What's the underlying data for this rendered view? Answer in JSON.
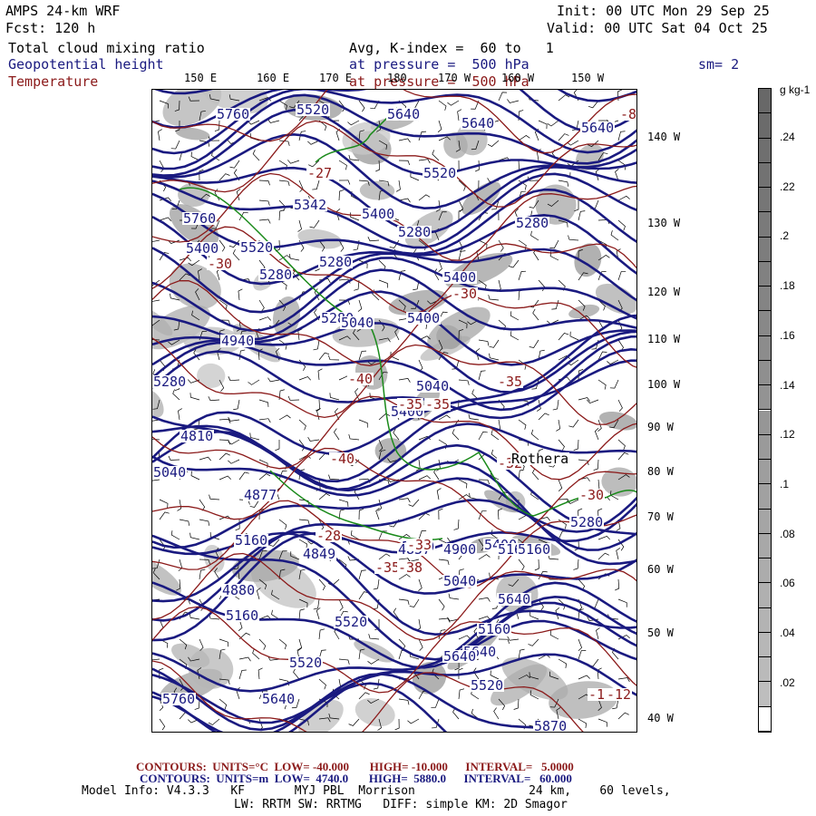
{
  "header": {
    "model": "AMPS 24-km WRF",
    "forecast": "Fcst: 120 h",
    "init": "Init: 00 UTC Mon 29 Sep 25",
    "valid": "Valid: 00 UTC Sat 04 Oct 25",
    "field1": "Total cloud mixing ratio",
    "field1_avg": "Avg, K-index =  60 to   1",
    "field2": "Geopotential height",
    "field2_level": "at pressure =  500 hPa",
    "smoothing": "sm= 2",
    "field3": "Temperature",
    "field3_level": "at pressure =  500 hPa"
  },
  "colors": {
    "blue": "#1a1a80",
    "red": "#8b1a1a",
    "green": "#1a8a1a"
  },
  "lon_labels": [
    "150 E",
    "160 E",
    "170 E",
    "180",
    "170 W",
    "160 W",
    "150 W"
  ],
  "lat_labels": [
    "140 W",
    "130 W",
    "120 W",
    "110 W",
    "100 W",
    "90 W",
    "80 W",
    "70 W",
    "60 W",
    "50 W",
    "40 W"
  ],
  "colorbar": {
    "units": "g kg-1",
    "labels": [
      ".24",
      ".22",
      ".2",
      ".18",
      ".16",
      ".14",
      ".12",
      ".1",
      ".08",
      ".06",
      ".04",
      ".02"
    ],
    "min": 0,
    "max": 0.26,
    "interval": 0.01
  },
  "height_labels": [
    "5520",
    "5640",
    "5640",
    "5760",
    "5400",
    "5520",
    "5280",
    "5400",
    "5280",
    "5760",
    "5640",
    "5520",
    "5280",
    "5342",
    "5280",
    "5280",
    "5040",
    "4940",
    "5040",
    "5400",
    "5280",
    "4810",
    "5040",
    "4880",
    "5160",
    "5400",
    "5400",
    "5400",
    "5520",
    "5160",
    "5640",
    "5520",
    "5040",
    "5160",
    "5040",
    "4857",
    "4900",
    "5160",
    "5640",
    "5640",
    "5520",
    "5640",
    "5760",
    "5870",
    "4877",
    "4849",
    "5280",
    "5160"
  ],
  "temp_labels": [
    "-27",
    "-30",
    "-40",
    "-35",
    "-35",
    "-35",
    "-40",
    "-33",
    "-28",
    "-35",
    "-30",
    "-38",
    "-15",
    "-12",
    "-8",
    "-30",
    "-32"
  ],
  "place_labels": [
    "Rothera"
  ],
  "contour_info": {
    "temp": "CONTOURS:  UNITS=°C  LOW= -40.000       HIGH= -10.000      INTERVAL=   5.0000",
    "height": "CONTOURS:  UNITS=m  LOW=  4740.0       HIGH=  5880.0      INTERVAL=   60.000"
  },
  "model_info": {
    "line1": "Model Info: V4.3.3   KF       MYJ PBL  Morrison                24 km,    60 levels,",
    "line2": "LW: RRTM SW: RRTMG   DIFF: simple KM: 2D Smagor"
  }
}
